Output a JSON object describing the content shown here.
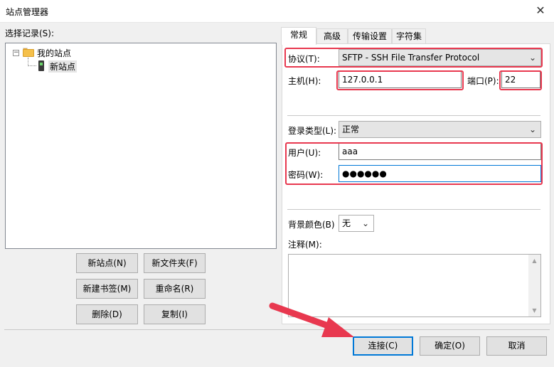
{
  "window": {
    "title": "站点管理器",
    "close_glyph": "✕"
  },
  "left": {
    "select_label": "选择记录(S):",
    "tree": {
      "expander_glyph": "−",
      "root_label": "我的站点",
      "site_label": "新站点"
    },
    "buttons": {
      "new_site": "新站点(N)",
      "new_folder": "新文件夹(F)",
      "new_bookmark": "新建书签(M)",
      "rename": "重命名(R)",
      "delete": "删除(D)",
      "copy": "复制(I)"
    }
  },
  "tabs": [
    "常规",
    "高级",
    "传输设置",
    "字符集"
  ],
  "general": {
    "protocol_label": "协议(T):",
    "protocol_value": "SFTP - SSH File Transfer Protocol",
    "host_label": "主机(H):",
    "host_value": "127.0.0.1",
    "port_label": "端口(P):",
    "port_value": "22",
    "logon_type_label": "登录类型(L):",
    "logon_type_value": "正常",
    "user_label": "用户(U):",
    "user_value": "aaa",
    "password_label": "密码(W):",
    "password_value": "●●●●●●",
    "bg_color_label": "背景颜色(B)",
    "bg_color_value": "无",
    "comments_label": "注释(M):",
    "chevron_glyph": "⌄",
    "scroll_up_glyph": "▲",
    "scroll_down_glyph": "▼"
  },
  "footer": {
    "connect": "连接(C)",
    "ok": "确定(O)",
    "cancel": "取消"
  },
  "colors": {
    "highlight_red": "#e8384f",
    "accent_blue": "#0078d7"
  }
}
